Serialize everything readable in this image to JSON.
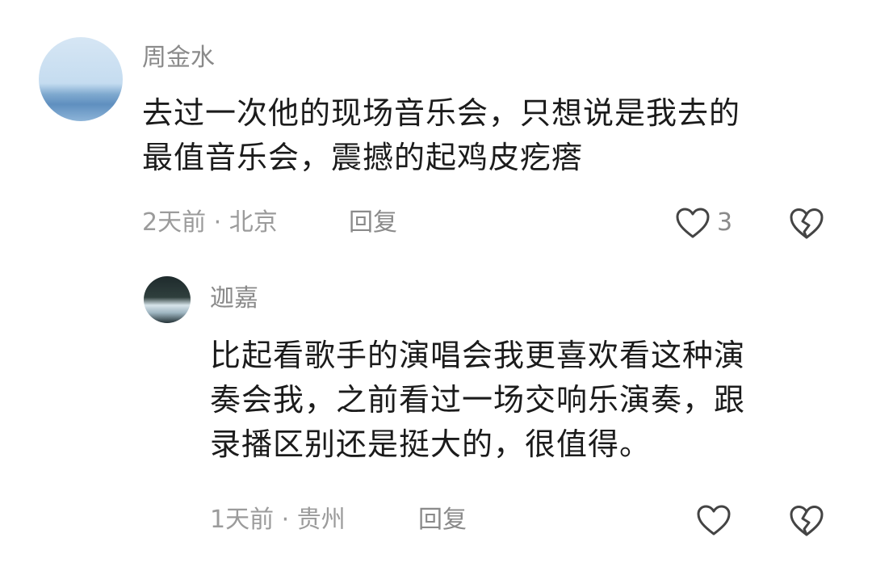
{
  "comment": {
    "username": "周金水",
    "content_lines": [
      "去过一次他的现场音乐会，只想说是我去的",
      "最值音乐会，震撼的起鸡皮疙瘩"
    ],
    "meta": "2天前 · 北京",
    "reply_label": "回复",
    "like_count": "3",
    "icons": {
      "like": "heart-outline-icon",
      "dislike": "broken-heart-icon"
    }
  },
  "reply": {
    "username": "迦嘉",
    "content_lines": [
      "比起看歌手的演唱会我更喜欢看这种演",
      "奏会我，之前看过一场交响乐演奏，跟",
      "录播区别还是挺大的，很值得。"
    ],
    "meta": "1天前 · 贵州",
    "reply_label": "回复",
    "icons": {
      "like": "heart-outline-icon",
      "dislike": "broken-heart-icon"
    }
  },
  "colors": {
    "secondary_text": "#8a8a8a",
    "primary_text": "#1b1b1b",
    "icon_stroke": "#444444"
  }
}
